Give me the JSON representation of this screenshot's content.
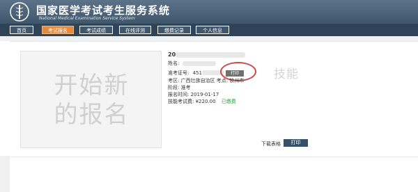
{
  "header": {
    "title": "国家医学考试考生服务系统",
    "subtitle": "National Medical Examination Service System"
  },
  "nav": {
    "items": [
      {
        "label": "首页"
      },
      {
        "label": "考试报名"
      },
      {
        "label": "考试成绩"
      },
      {
        "label": "在线评测"
      },
      {
        "label": "缴费记录"
      },
      {
        "label": "个人信息"
      }
    ],
    "active": "考试报名"
  },
  "new_registration": {
    "line1": "开始新",
    "line2": "的报名"
  },
  "record": {
    "year": "20",
    "name_label": "姓名:",
    "ticket_label": "准考证号:",
    "ticket_value": "451",
    "region_line": "考区:  广西壮族自治区  考点:  钦州市",
    "stage_line": "阶段:  准考",
    "date_line": "报名时间:  2019-01-17",
    "fee_label": "技能考试费:  ¥220.00",
    "fee_status": "已缴费",
    "print_small": "打印",
    "skill_watermark": "技能"
  },
  "actions": {
    "download": "下载表格",
    "print": "打印"
  },
  "colors": {
    "header": "#4a6075",
    "active_tab": "#e48a3d",
    "paid": "#2e9e4a",
    "highlight": "#c94a4a"
  }
}
